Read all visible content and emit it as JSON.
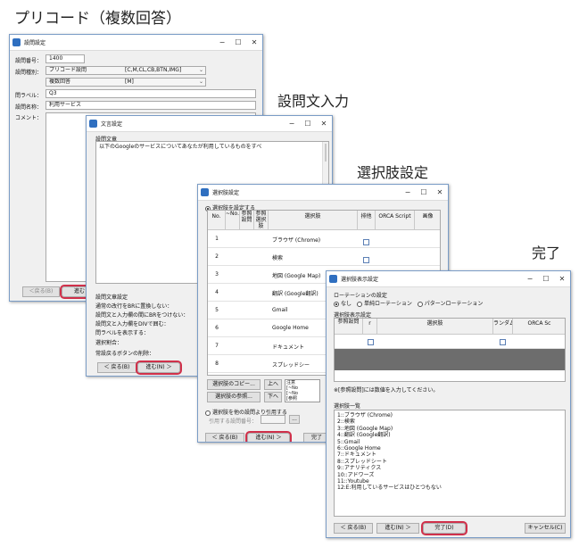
{
  "captions": {
    "main": "プリコード（複数回答）",
    "step1": "設問文入力",
    "step2": "選択肢設定",
    "step3": "完了"
  },
  "win_question": {
    "title": "設問設定",
    "label_number": "設問番号：",
    "number": "1400",
    "label_type": "設問種別：",
    "type": "プリコード設問",
    "type_codes": "[C,M,CL,CB,BTN,IMG]",
    "subtype": "複数回答",
    "subtype_code": "[M]",
    "label_qlabel": "問ラベル：",
    "qlabel": "Q3",
    "label_name": "設問名称：",
    "name": "利用サービス",
    "label_comment": "コメント：",
    "back": "＜戻る(B)",
    "next": "進む"
  },
  "win_text": {
    "title": "文言設定",
    "label_text": "設問文章",
    "text": "以下のGoogleのサービスについてあなたが利用しているものをすべ",
    "settings_title": "設問文章設定",
    "settings": [
      "通常の改行をBRに置換しない：",
      "設問文と入力欄の間にBRをつけない：",
      "設問文と入力欄をDIVで囲む：",
      "問ラベルを表示する：",
      "選択割合：",
      "常設戻るボタンの削除："
    ],
    "back": "＜ 戻る(B)",
    "next": "進む(N) ＞"
  },
  "win_choice": {
    "title": "選択肢設定",
    "radio_set": "選択肢を設定する",
    "headers": {
      "no": "No.",
      "sub": "~No.",
      "ref_q": "参照設問",
      "ref_c": "参照選択肢",
      "choice": "選択肢",
      "excl": "排他",
      "orca": "ORCA Script",
      "img": "画像"
    },
    "rows": [
      {
        "no": "1",
        "label": "ブラウザ (Chrome)"
      },
      {
        "no": "2",
        "label": "検索"
      },
      {
        "no": "3",
        "label": "地図 (Google Map)"
      },
      {
        "no": "4",
        "label": "翻訳 (Google翻訳)"
      },
      {
        "no": "5",
        "label": "Gmail"
      },
      {
        "no": "6",
        "label": "Google Home"
      },
      {
        "no": "7",
        "label": "ドキュメント"
      },
      {
        "no": "8",
        "label": "スプレッドシー"
      }
    ],
    "copy_btn": "選択肢のコピー...",
    "ref_btn": "選択肢の参照...",
    "up": "上へ",
    "down": "下へ",
    "note1": "注意",
    "note2": "[~No",
    "note3": "[~No",
    "note4": "[参照",
    "radio_ref": "選択肢を他の設問より引用する",
    "ref_label": "引用する設問番号：",
    "ellipsis": "...",
    "back": "＜ 戻る(B)",
    "next": "進む(N) ＞",
    "finish": "完了"
  },
  "win_display": {
    "title": "選択肢表示設定",
    "rotation_title": "ローテーションの設定",
    "rot_none": "なし",
    "rot_simple": "単純ローテーション",
    "rot_pattern": "パターンローテーション",
    "display_title": "選択肢表示設定",
    "headers": {
      "ref": "参照設問",
      "r": "r",
      "choice": "選択肢",
      "random": "ランダム",
      "orca": "ORCA Sc"
    },
    "note": "※[参照設問]には数値を入力してください。",
    "list_title": "選択肢一覧",
    "list": [
      "1::ブラウザ (Chrome)",
      "2::検索",
      "3::地図 (Google Map)",
      "4::翻訳 (Google翻訳)",
      "5::Gmail",
      "6::Google Home",
      "7::ドキュメント",
      "8::スプレッドシート",
      "9::アナリティクス",
      "10::アドワーズ",
      "11::Youtube",
      "12:E:利用しているサービスはひとつもない"
    ],
    "back": "＜ 戻る(B)",
    "next": "進む(N) ＞",
    "finish": "完了(D)",
    "cancel": "キャンセル(C)"
  },
  "controls": {
    "minimize": "−",
    "maximize": "☐",
    "close": "✕"
  }
}
